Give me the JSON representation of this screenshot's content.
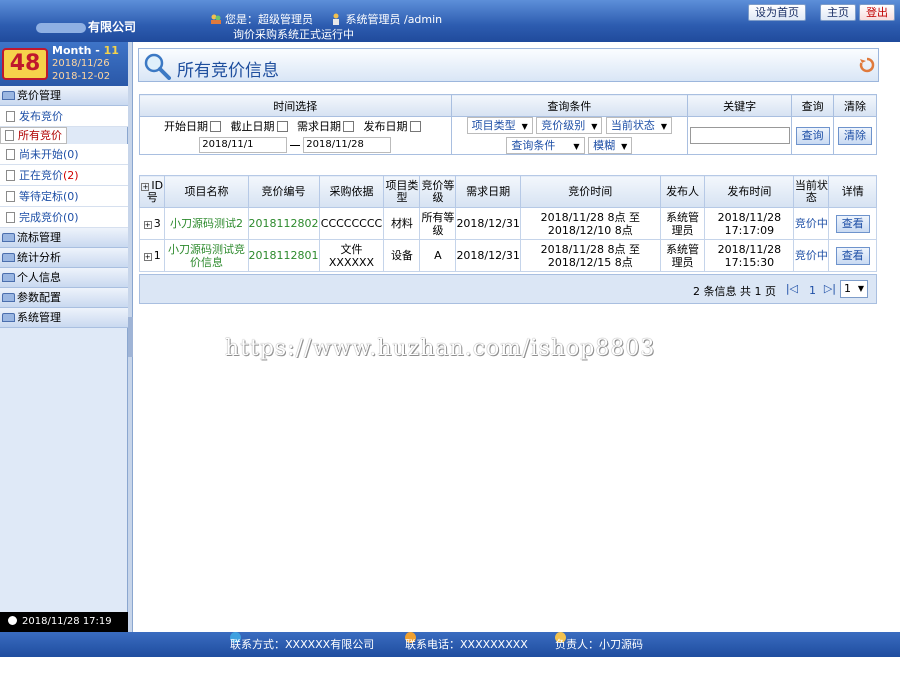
{
  "header": {
    "company": "有限公司",
    "greeting_label": "您是：",
    "role": "超级管理员",
    "user_type": "系统管理员",
    "username": "/admin",
    "status": "询价采购系统正式运行中",
    "btn_home": "设为首页",
    "btn_main": "主页",
    "btn_logout": "登出"
  },
  "datebox": {
    "day": "48",
    "month_label": "Month - ",
    "month_num": "11",
    "date1": "2018/11/26",
    "date2": "2018-12-02"
  },
  "sidebar": {
    "groups": [
      {
        "label": "竞价管理"
      },
      {
        "label": "流标管理"
      },
      {
        "label": "统计分析"
      },
      {
        "label": "个人信息"
      },
      {
        "label": "参数配置"
      },
      {
        "label": "系统管理"
      }
    ],
    "items": [
      {
        "label": "发布竞价",
        "count": ""
      },
      {
        "label": "所有竞价",
        "count": ""
      },
      {
        "label": "尚未开始",
        "count": "(0)"
      },
      {
        "label": "正在竞价",
        "count": "(2)"
      },
      {
        "label": "等待定标",
        "count": "(0)"
      },
      {
        "label": "完成竞价",
        "count": "(0)"
      }
    ],
    "clock": "2018/11/28  17:19"
  },
  "main": {
    "title": "所有竞价信息"
  },
  "filters": {
    "headers": [
      "时间选择",
      "查询条件",
      "关键字",
      "查询",
      "清除"
    ],
    "date_checks": [
      "开始日期",
      "截止日期",
      "需求日期",
      "发布日期"
    ],
    "date_from": "2018/11/1",
    "date_to": "2018/11/28",
    "selects": [
      "项目类型",
      "竞价级别",
      "当前状态",
      "查询条件",
      "模糊"
    ],
    "keyword": "",
    "query_btn": "查询",
    "clear_btn": "清除"
  },
  "results": {
    "headers": [
      "ID号",
      "项目名称",
      "竞价编号",
      "采购依据",
      "项目类型",
      "竞价等级",
      "需求日期",
      "竞价时间",
      "发布人",
      "发布时间",
      "当前状态",
      "详情"
    ],
    "rows": [
      {
        "id": "3",
        "name": "小刀源码测试2",
        "no": "2018112802",
        "basis": "CCCCCCCC",
        "type": "材料",
        "level": "所有等级",
        "need": "2018/12/31",
        "time": "2018/11/28 8点 至 2018/12/10 8点",
        "publisher": "系统管理员",
        "pubtime": "2018/11/28 17:17:09",
        "status": "竞价中",
        "detail": "查看"
      },
      {
        "id": "1",
        "name": "小刀源码测试竞价信息",
        "no": "2018112801",
        "basis": "文件XXXXXX",
        "type": "设备",
        "level": "A",
        "need": "2018/12/31",
        "time": "2018/11/28 8点 至 2018/12/15 8点",
        "publisher": "系统管理员",
        "pubtime": "2018/11/28 17:15:30",
        "status": "竞价中",
        "detail": "查看"
      }
    ],
    "pager_info": "2 条信息  共 1 页",
    "pager_first": "|◁",
    "pager_page": "1",
    "pager_last": "▷|",
    "pager_select": "1"
  },
  "watermark": "https://www.huzhan.com/ishop8803",
  "footer": {
    "contact": "联系方式：XXXXXX有限公司",
    "phone": "联系电话：XXXXXXXXX",
    "owner": "负责人：小刀源码"
  },
  "colors": {
    "header_blue": "#2d5cb0",
    "link_blue": "#1e4fa6",
    "green": "#2d8a2d",
    "alert_red": "#d00000"
  }
}
